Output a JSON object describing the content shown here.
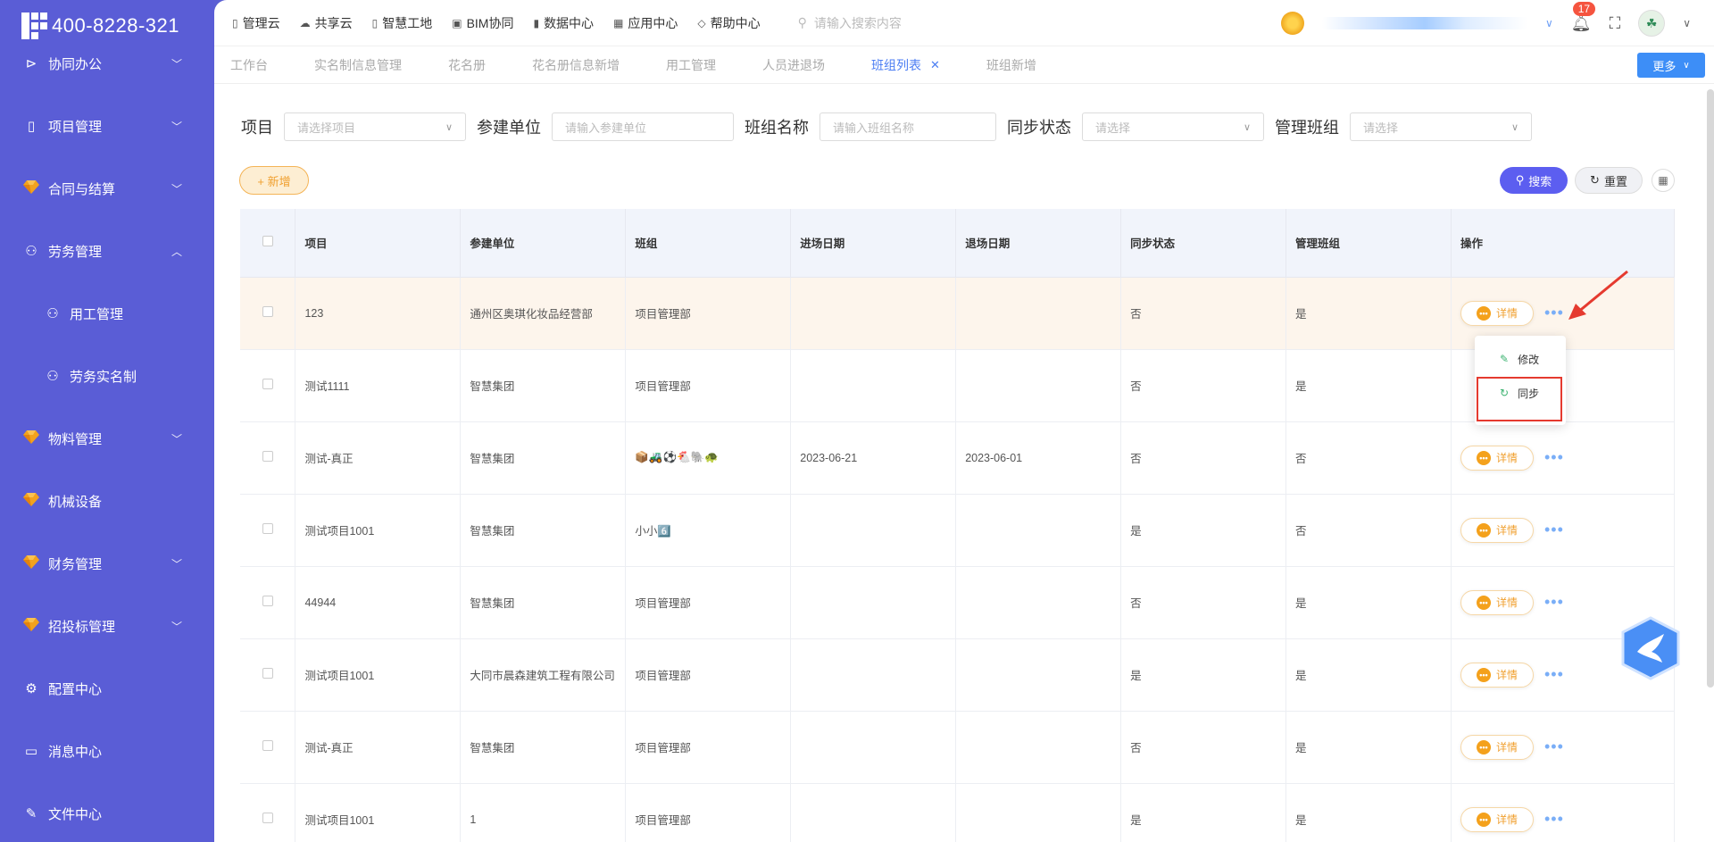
{
  "brand": {
    "phone": "400-8228-321"
  },
  "sidebar": {
    "items": [
      {
        "label": "协同办公",
        "icon": "send-icon",
        "glyph": "⊳",
        "chevron": "down"
      },
      {
        "label": "项目管理",
        "icon": "book-icon",
        "glyph": "▯",
        "chevron": "down"
      },
      {
        "label": "合同与结算",
        "icon": "gem-icon",
        "glyph": "gem",
        "chevron": "down"
      },
      {
        "label": "劳务管理",
        "icon": "user-icon",
        "glyph": "⚇",
        "chevron": "up"
      },
      {
        "label": "用工管理",
        "icon": "user-icon",
        "glyph": "⚇",
        "sub": true
      },
      {
        "label": "劳务实名制",
        "icon": "users-icon",
        "glyph": "⚇",
        "sub": true
      },
      {
        "label": "物料管理",
        "icon": "gem-icon",
        "glyph": "gem",
        "chevron": "down"
      },
      {
        "label": "机械设备",
        "icon": "gem-icon",
        "glyph": "gem"
      },
      {
        "label": "财务管理",
        "icon": "gem-icon",
        "glyph": "gem",
        "chevron": "down"
      },
      {
        "label": "招投标管理",
        "icon": "gem-icon",
        "glyph": "gem",
        "chevron": "down"
      },
      {
        "label": "配置中心",
        "icon": "gear-icon",
        "glyph": "⚙"
      },
      {
        "label": "消息中心",
        "icon": "message-icon",
        "glyph": "▭"
      },
      {
        "label": "文件中心",
        "icon": "file-icon",
        "glyph": "✎"
      }
    ]
  },
  "topnav": [
    {
      "label": "管理云",
      "icon": "book-icon",
      "glyph": "▯"
    },
    {
      "label": "共享云",
      "icon": "cloud-icon",
      "glyph": "☁"
    },
    {
      "label": "智慧工地",
      "icon": "book-icon",
      "glyph": "▯"
    },
    {
      "label": "BIM协同",
      "icon": "box-icon",
      "glyph": "▣"
    },
    {
      "label": "数据中心",
      "icon": "bar-chart-icon",
      "glyph": "▮"
    },
    {
      "label": "应用中心",
      "icon": "apps-icon",
      "glyph": "▦"
    },
    {
      "label": "帮助中心",
      "icon": "help-icon",
      "glyph": "◇"
    }
  ],
  "search": {
    "placeholder": "请输入搜索内容"
  },
  "notifications": {
    "count": "17"
  },
  "tabs": [
    {
      "label": "工作台"
    },
    {
      "label": "实名制信息管理"
    },
    {
      "label": "花名册"
    },
    {
      "label": "花名册信息新增"
    },
    {
      "label": "用工管理"
    },
    {
      "label": "人员进退场"
    },
    {
      "label": "班组列表",
      "active": true
    },
    {
      "label": "班组新增"
    }
  ],
  "more_button": "更多",
  "filters": [
    {
      "label": "项目",
      "placeholder": "请选择项目",
      "type": "select"
    },
    {
      "label": "参建单位",
      "placeholder": "请输入参建单位",
      "type": "input"
    },
    {
      "label": "班组名称",
      "placeholder": "请输入班组名称",
      "type": "input"
    },
    {
      "label": "同步状态",
      "placeholder": "请选择",
      "type": "select"
    },
    {
      "label": "管理班组",
      "placeholder": "请选择",
      "type": "select"
    }
  ],
  "buttons": {
    "add": "+ 新增",
    "search": "搜索",
    "reset": "重置"
  },
  "table": {
    "headers": [
      "项目",
      "参建单位",
      "班组",
      "进场日期",
      "退场日期",
      "同步状态",
      "管理班组",
      "操作"
    ],
    "rows": [
      [
        "123",
        "通州区奥琪化妆品经营部",
        "项目管理部",
        "",
        "",
        "否",
        "是"
      ],
      [
        "测试1111",
        "智慧集团",
        "项目管理部",
        "",
        "",
        "否",
        "是"
      ],
      [
        "测试-真正",
        "智慧集团",
        "📦🚜⚽🐔🐘🐢",
        "2023-06-21",
        "2023-06-01",
        "否",
        "否"
      ],
      [
        "测试项目1001",
        "智慧集团",
        "小小6️⃣",
        "",
        "",
        "是",
        "否"
      ],
      [
        "44944",
        "智慧集团",
        "项目管理部",
        "",
        "",
        "否",
        "是"
      ],
      [
        "测试项目1001",
        "大同市晨森建筑工程有限公司",
        "项目管理部",
        "",
        "",
        "是",
        "是"
      ],
      [
        "测试-真正",
        "智慧集团",
        "项目管理部",
        "",
        "",
        "否",
        "是"
      ],
      [
        "测试项目1001",
        "1",
        "项目管理部",
        "",
        "",
        "是",
        "是"
      ]
    ],
    "detail_label": "详情"
  },
  "popup": {
    "edit": "修改",
    "sync": "同步"
  },
  "colors": {
    "sidebar": "#5a5dd6",
    "accent": "#5c5ef0",
    "warning": "#f4a11c",
    "highlight": "#e53a2f"
  }
}
